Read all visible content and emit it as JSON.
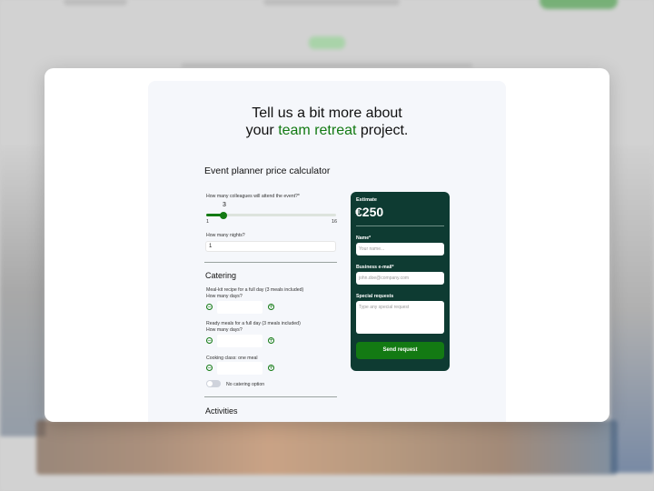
{
  "headline": {
    "line1": "Tell us a bit more about",
    "prefix": "your ",
    "accent": "team retreat",
    "suffix": " project."
  },
  "calculator_title": "Event planner price calculator",
  "colleagues": {
    "label": "How many colleagues will attend the event?*",
    "value": "3",
    "min": "1",
    "max": "16"
  },
  "nights": {
    "label": "How many nights?",
    "value": "1"
  },
  "catering": {
    "title": "Catering",
    "items": [
      {
        "label1": "Meal-kit recipe for a full day (3 meals included)",
        "label2": "How many days?"
      },
      {
        "label1": "Ready meals for a full day (3 meals included)",
        "label2": "How many days?"
      },
      {
        "label1": "Cooking class: one meal",
        "label2": ""
      }
    ],
    "minus_symbol": "−",
    "plus_symbol": "+",
    "no_catering_label": "No catering option"
  },
  "activities_title": "Activities",
  "estimate": {
    "label": "Estimate",
    "value": "€250",
    "name_label": "Name*",
    "name_placeholder": "Your name...",
    "email_label": "Business e-mail*",
    "email_placeholder": "john.doe@company.com",
    "requests_label": "Special requests",
    "requests_placeholder": "Type any special request",
    "send_label": "Send request"
  },
  "colors": {
    "accent": "#137a13",
    "card": "#0e3b32"
  },
  "icons": [
    "minus-circle-icon",
    "plus-circle-icon"
  ]
}
